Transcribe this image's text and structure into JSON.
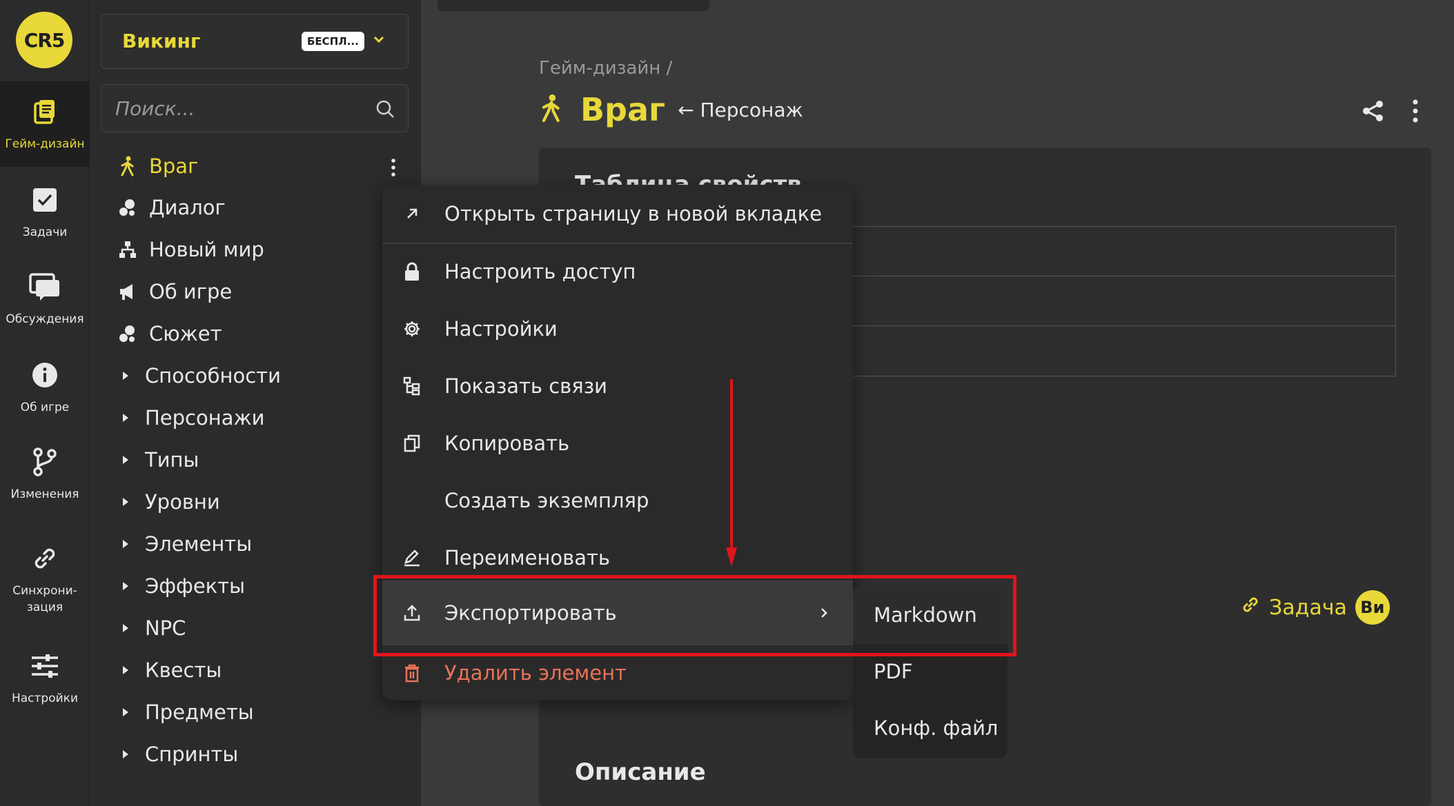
{
  "rail": {
    "logo": "CR5",
    "items": [
      {
        "label": "Гейм-дизайн",
        "icon": "document-stack-icon",
        "active": true
      },
      {
        "label": "Задачи",
        "icon": "checkbox-icon"
      },
      {
        "label": "Обсуждения",
        "icon": "chat-icon"
      },
      {
        "label": "Об игре",
        "icon": "info-icon"
      },
      {
        "label": "Изменения",
        "icon": "branch-icon"
      },
      {
        "label": "Синхрони-\nзация",
        "icon": "link-icon"
      },
      {
        "label": "Настройки",
        "icon": "sliders-icon"
      }
    ]
  },
  "sidebar": {
    "workspace_name": "Викинг",
    "plan_badge": "БЕСПЛ...",
    "search_placeholder": "Поиск...",
    "items": [
      {
        "label": "Враг",
        "icon": "walking-person-icon",
        "active": true
      },
      {
        "label": "Диалог",
        "icon": "bubbles-icon"
      },
      {
        "label": "Новый мир",
        "icon": "hierarchy-icon"
      },
      {
        "label": "Об игре",
        "icon": "megaphone-icon"
      },
      {
        "label": "Сюжет",
        "icon": "bubbles-icon"
      }
    ],
    "groups": [
      "Способности",
      "Персонажи",
      "Типы",
      "Уровни",
      "Элементы",
      "Эффекты",
      "NPC",
      "Квесты",
      "Предметы",
      "Спринты"
    ]
  },
  "main": {
    "breadcrumb": "Гейм-дизайн /",
    "title": "Враг",
    "type_link": "← Персонаж",
    "card_title": "Таблица свойств",
    "task_link": "Задача",
    "avatar": "Ви",
    "section_title": "Описание"
  },
  "context_menu": {
    "items": [
      {
        "label": "Открыть страницу в новой вкладке",
        "icon": "arrow-up-right-icon"
      },
      {
        "label": "Настроить доступ",
        "icon": "lock-icon"
      },
      {
        "label": "Настройки",
        "icon": "gear-icon"
      },
      {
        "label": "Показать связи",
        "icon": "tree-icon"
      },
      {
        "label": "Копировать",
        "icon": "copy-icon"
      },
      {
        "label": "Создать экземпляр",
        "icon": ""
      },
      {
        "label": "Переименовать",
        "icon": "pencil-icon"
      },
      {
        "label": "Экспортировать",
        "icon": "upload-icon",
        "hover": true
      },
      {
        "label": "Удалить элемент",
        "icon": "trash-icon",
        "danger": true
      }
    ],
    "submenu": [
      "Markdown",
      "PDF",
      "Конф. файл"
    ]
  },
  "colors": {
    "accent": "#e8d83a",
    "danger": "#e8735a",
    "annotation": "#e0151b"
  }
}
